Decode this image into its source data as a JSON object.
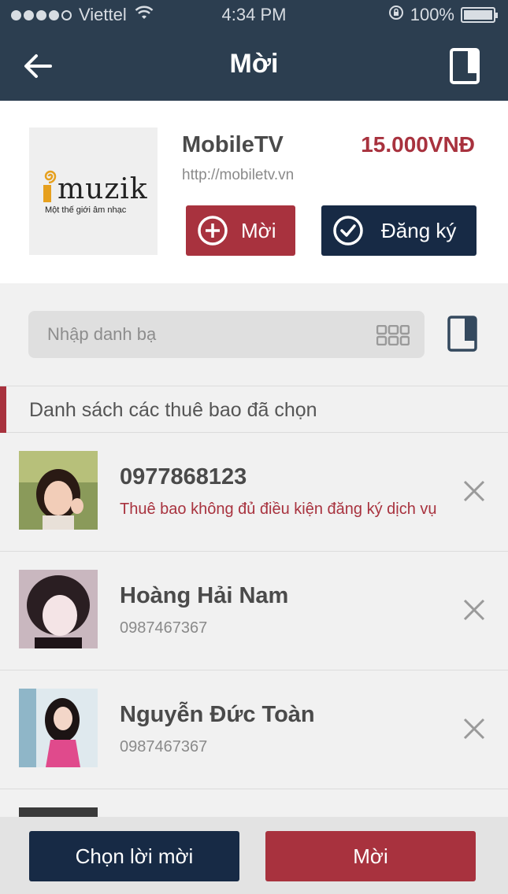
{
  "status_bar": {
    "carrier": "Viettel",
    "time": "4:34 PM",
    "battery": "100%",
    "signal_bars_filled": 4,
    "signal_bars_total": 5,
    "battery_level": 1.0
  },
  "nav": {
    "title": "Mời",
    "back_icon": "back-arrow-icon",
    "action_icon": "book-icon"
  },
  "product": {
    "logo_text": "muzik",
    "logo_tagline": "Một thế giới âm nhạc",
    "name": "MobileTV",
    "price": "15.000VNĐ",
    "url": "http://mobiletv.vn",
    "invite_label": "Mời",
    "register_label": "Đăng ký"
  },
  "search": {
    "placeholder": "Nhập danh bạ",
    "grid_icon": "grid-icon",
    "contacts_icon": "contacts-book-icon"
  },
  "section_title": "Danh sách các thuê bao đã chọn",
  "subscribers": [
    {
      "name": "0977868123",
      "detail": "Thuê bao không đủ điều kiện đăng ký dịch vụ",
      "detail_is_error": true
    },
    {
      "name": "Hoàng Hải Nam",
      "detail": "0987467367",
      "detail_is_error": false
    },
    {
      "name": "Nguyễn Đức Toàn",
      "detail": "0987467367",
      "detail_is_error": false
    }
  ],
  "bottom": {
    "choose_label": "Chọn lời mời",
    "invite_label": "Mời"
  },
  "colors": {
    "nav_bg": "#2c3e50",
    "accent_red": "#a8323e",
    "dark_navy": "#172a45",
    "logo_orange": "#e6a01e"
  }
}
